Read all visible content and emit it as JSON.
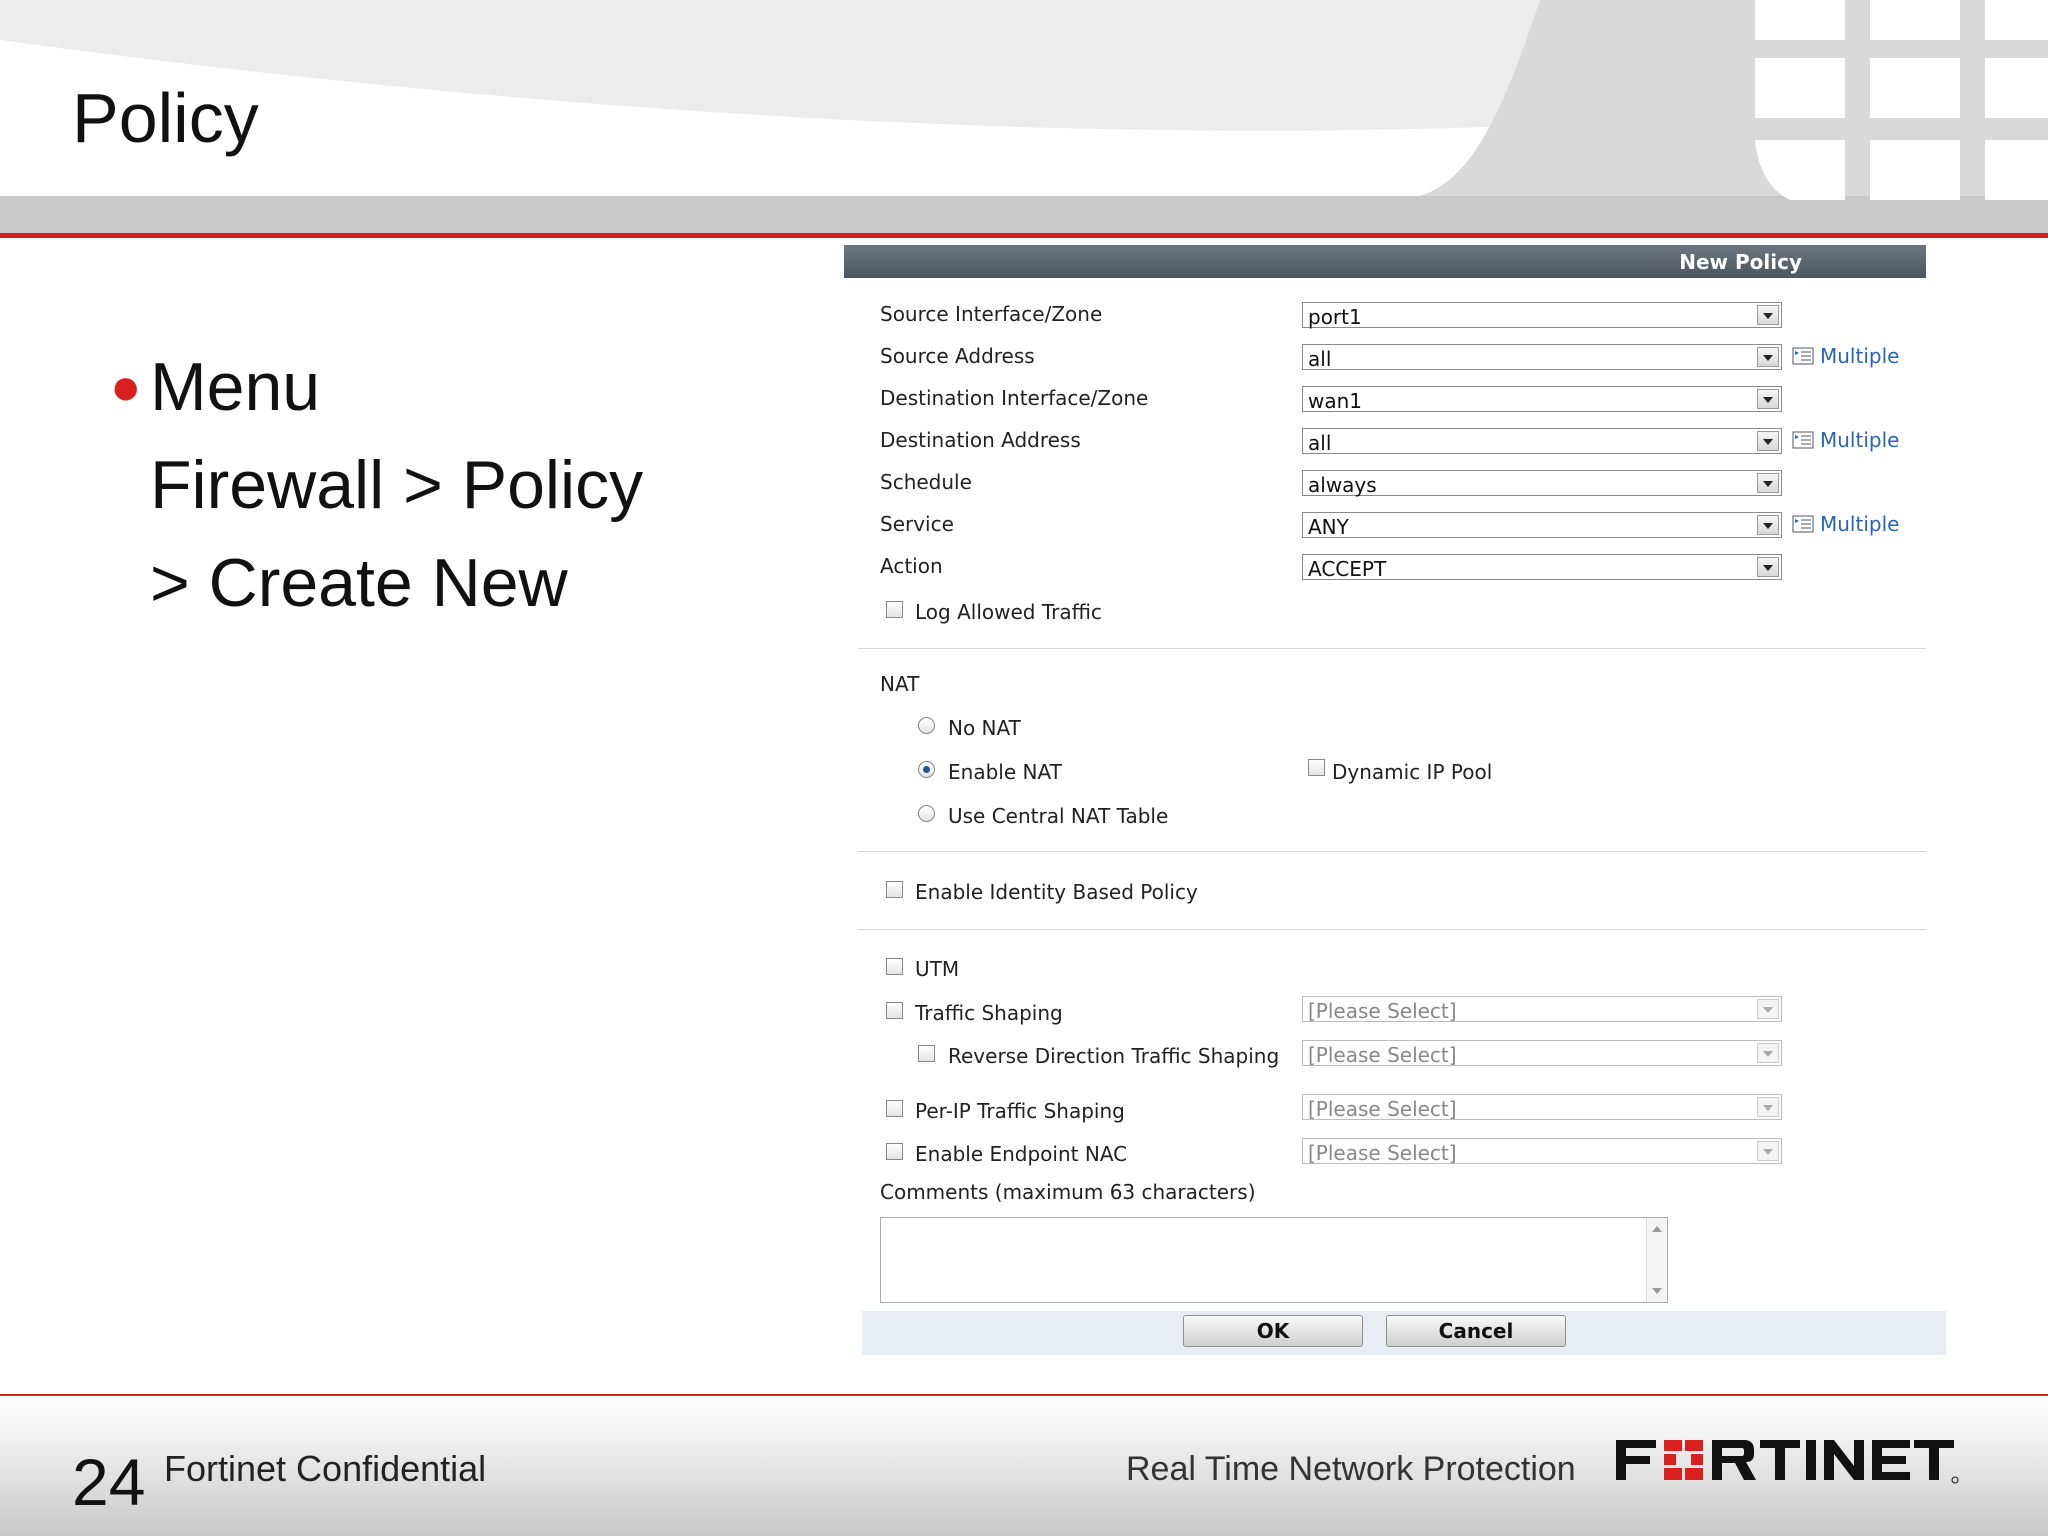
{
  "slide": {
    "title": "Policy",
    "bullet_lines": [
      "Menu",
      "Firewall > Policy",
      "> Create New"
    ],
    "page_number": "24",
    "footer_confidential": "Fortinet Confidential",
    "footer_tagline": "Real Time Network Protection",
    "logo_text": "FORTINET"
  },
  "dialog": {
    "title": "New Policy",
    "fields": [
      {
        "label": "Source Interface/Zone",
        "value": "port1"
      },
      {
        "label": "Source Address",
        "value": "all",
        "multiple": "Multiple"
      },
      {
        "label": "Destination Interface/Zone",
        "value": "wan1"
      },
      {
        "label": "Destination Address",
        "value": "all",
        "multiple": "Multiple"
      },
      {
        "label": "Schedule",
        "value": "always"
      },
      {
        "label": "Service",
        "value": "ANY",
        "multiple": "Multiple"
      },
      {
        "label": "Action",
        "value": "ACCEPT"
      }
    ],
    "log_allowed": "Log Allowed Traffic",
    "nat": {
      "title": "NAT",
      "options": [
        "No NAT",
        "Enable NAT",
        "Use Central NAT Table"
      ],
      "selected": "Enable NAT",
      "dynamic_ip_pool": "Dynamic IP Pool"
    },
    "identity_policy": "Enable Identity Based Policy",
    "utm": "UTM",
    "traffic_shaping": {
      "label": "Traffic Shaping",
      "placeholder": "[Please Select]"
    },
    "reverse_shaping": {
      "label": "Reverse Direction Traffic Shaping",
      "placeholder": "[Please Select]"
    },
    "per_ip_shaping": {
      "label": "Per-IP Traffic Shaping",
      "placeholder": "[Please Select]"
    },
    "endpoint_nac": {
      "label": "Enable Endpoint NAC",
      "placeholder": "[Please Select]"
    },
    "comments_label": "Comments (maximum 63 characters)",
    "ok": "OK",
    "cancel": "Cancel"
  },
  "colors": {
    "accent_red": "#d8201f",
    "header_gray": "#5a626a",
    "link_blue": "#2a64b8"
  }
}
